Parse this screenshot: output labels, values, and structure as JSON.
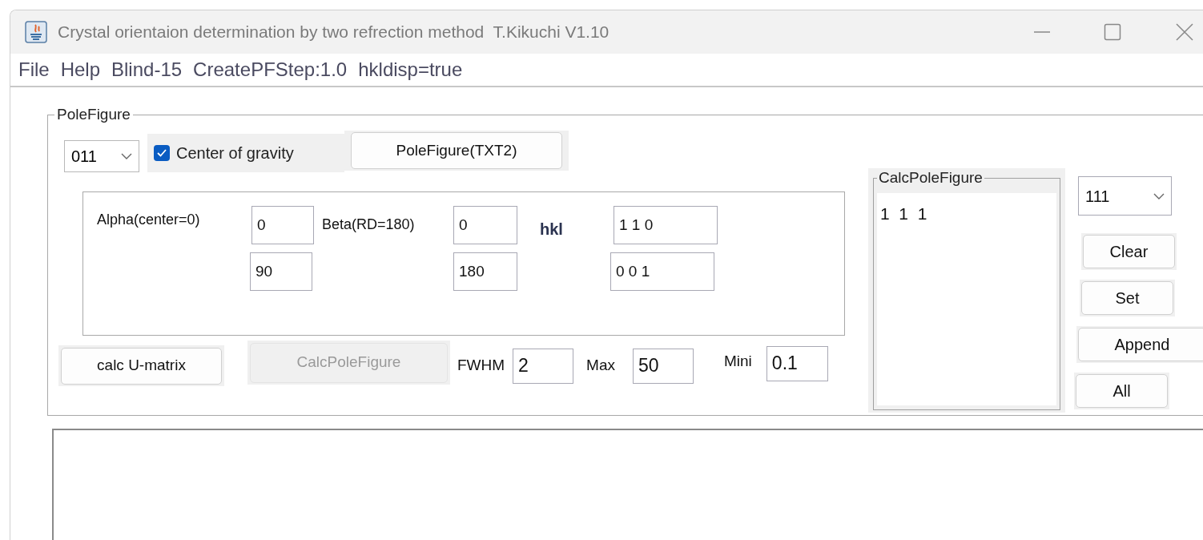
{
  "window": {
    "title": "Crystal orientaion determination by two refrection method  T.Kikuchi V1.10"
  },
  "menu": [
    "File",
    "Help",
    "Blind-15",
    "CreatePFStep:1.0",
    "hkldisp=true"
  ],
  "pole_figure": {
    "title": "PoleFigure",
    "plane_select": {
      "value": "011"
    },
    "center_of_gravity": {
      "label": "Center of gravity",
      "checked": true
    },
    "polefigure_button": "PoleFigure(TXT2)",
    "alpha_label": "Alpha(center=0)",
    "alpha_values": [
      "0",
      "90"
    ],
    "beta_label": "Beta(RD=180)",
    "beta_values": [
      "0",
      "180"
    ],
    "hkl_label": "hkl",
    "hkl_values": [
      "1 1 0",
      "0 0 1"
    ],
    "calc_umatrix_button": "calc U-matrix",
    "calc_pole_figure_button": {
      "label": "CalcPoleFigure",
      "disabled": true
    },
    "params": [
      {
        "label": "FWHM",
        "value": "2"
      },
      {
        "label": "Max",
        "value": "50"
      },
      {
        "label": "Mini",
        "value": "0.1"
      }
    ]
  },
  "calc_pole_figure_list": {
    "title": "CalcPoleFigure",
    "items": [
      "1  1  1"
    ]
  },
  "hkl_select": {
    "value": "111"
  },
  "buttons": [
    "Clear",
    "Set",
    "Append",
    "All"
  ]
}
